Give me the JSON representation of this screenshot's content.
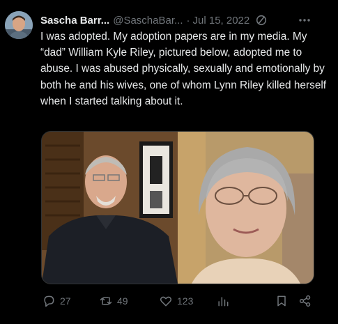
{
  "author": {
    "name": "Sascha Barr...",
    "handle": "@SaschaBar...",
    "separator": "·",
    "date": "Jul 15, 2022"
  },
  "tweet": {
    "text": "I was adopted. My adoption papers are in my media. My “dad” William Kyle Riley, pictured below, adopted me to abuse. I was abused physically, sexually and emotionally by both he and his wives, one of whom Lynn Riley killed herself when I started talking about it."
  },
  "media": {
    "images": [
      "man-photo",
      "woman-photo"
    ]
  },
  "actions": {
    "replies": "27",
    "retweets": "49",
    "likes": "123"
  },
  "icons": [
    "edit-icon",
    "more-icon",
    "reply-icon",
    "retweet-icon",
    "like-icon",
    "views-icon",
    "bookmark-icon",
    "share-icon"
  ],
  "colors": {
    "background": "#000000",
    "text": "#e7e9ea",
    "muted": "#71767b"
  }
}
